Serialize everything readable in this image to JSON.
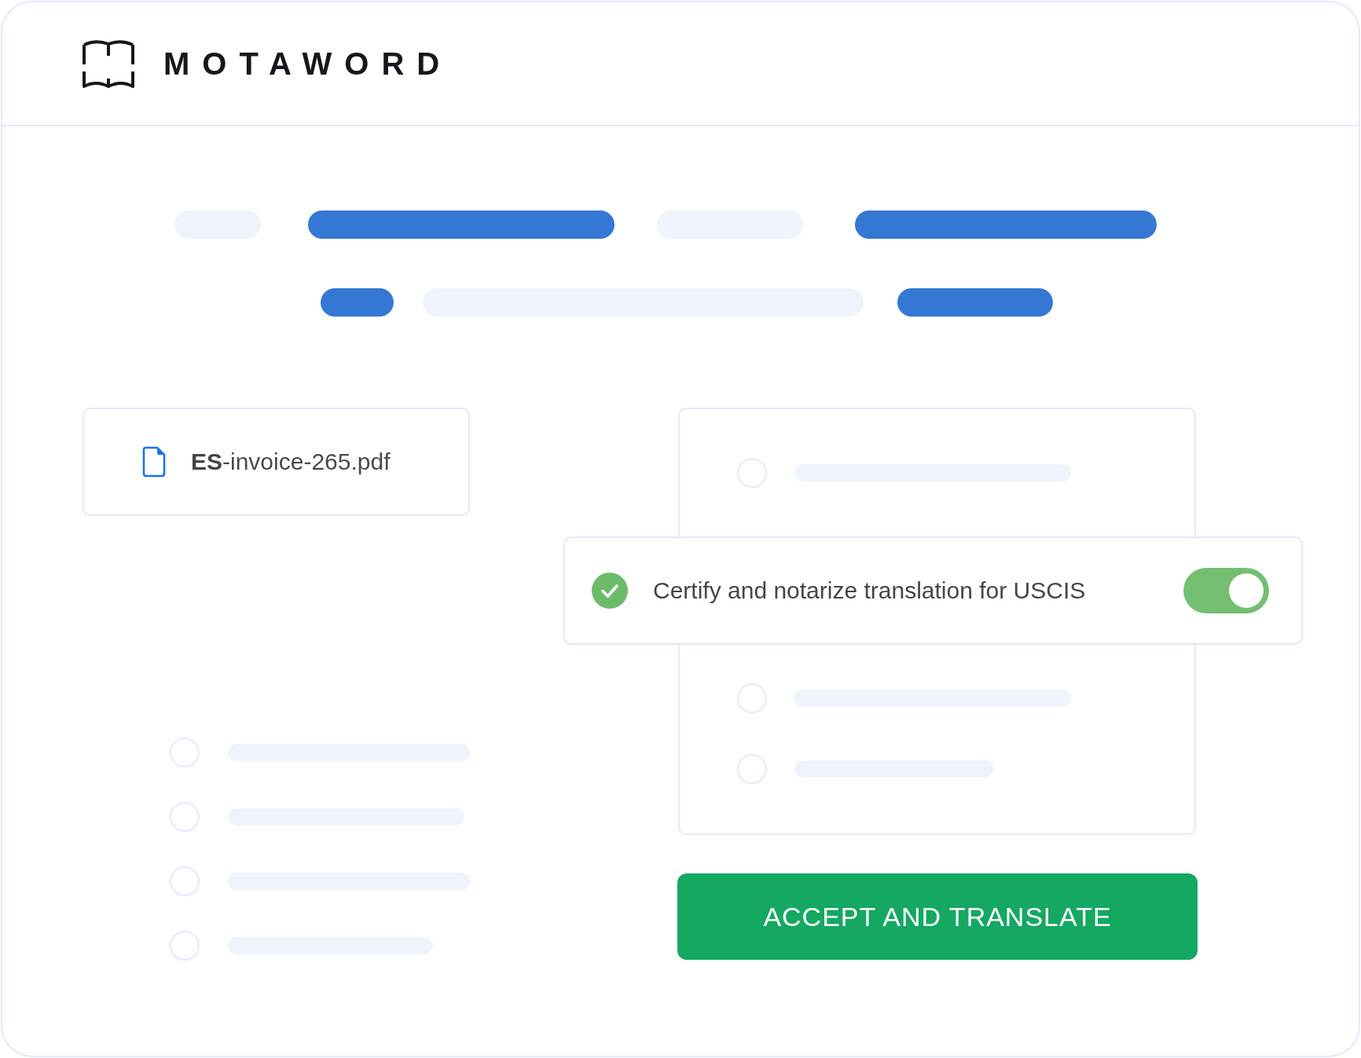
{
  "header": {
    "logo_text": "MOTAWORD"
  },
  "nav_placeholders": {
    "rows": [
      {
        "bars": [
          {
            "color": "#eef3fc"
          },
          {
            "color": "#3478d4"
          },
          {
            "color": "#eef3fc"
          },
          {
            "color": "#3478d4"
          }
        ]
      },
      {
        "bars": [
          {
            "color": "#3478d4"
          },
          {
            "color": "#eef3fc"
          },
          {
            "color": "#3478d4"
          }
        ]
      }
    ]
  },
  "file": {
    "name": "**ES**-invoice-265.pdf"
  },
  "left_options": [
    {
      "selected": false
    },
    {
      "selected": false
    },
    {
      "selected": false
    },
    {
      "selected": false
    }
  ],
  "options_card": {
    "options": [
      {
        "selected": false
      },
      {
        "selected": false
      },
      {
        "selected": false
      }
    ]
  },
  "certification": {
    "label": "Certify and notarize translation for USCIS",
    "on": true
  },
  "accept_button": {
    "label": "ACCEPT AND TRANSLATE"
  }
}
